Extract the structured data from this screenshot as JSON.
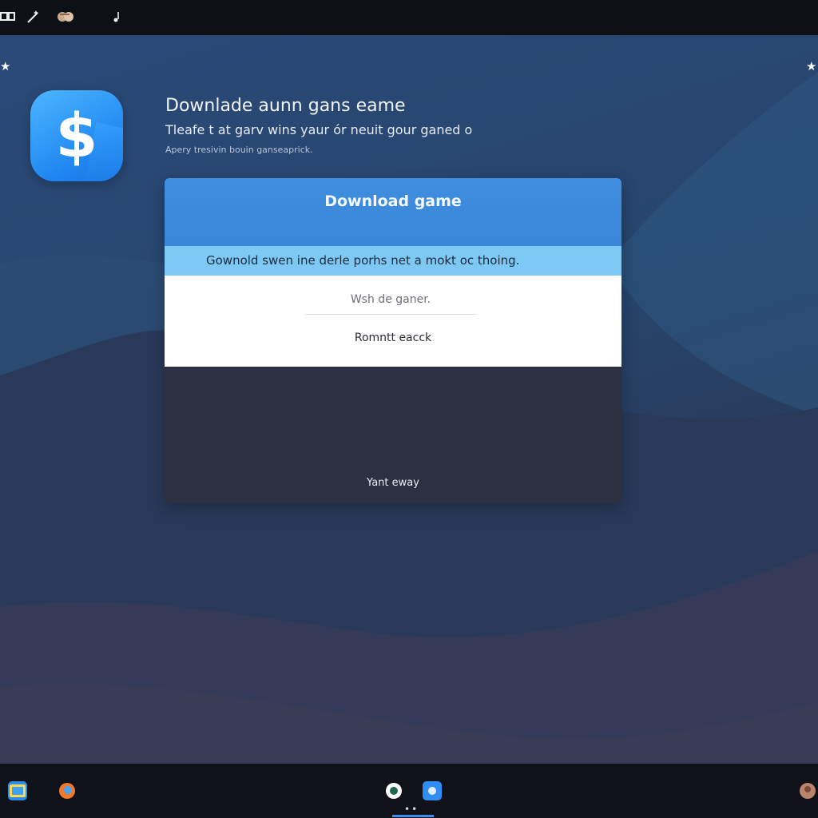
{
  "topbar": {
    "icons": [
      "window-icon",
      "magic-wand-icon",
      "hands-icon",
      "music-note-icon"
    ]
  },
  "app": {
    "icon_name": "dollar-sign-icon",
    "glyph": "$",
    "accent": "#2a8cf0"
  },
  "header": {
    "title": "Downlade aunn gans eame",
    "subtitle": "Tleafe t at garv wins yaur ór neuit gour ganed o",
    "caption": "Apery tresivin bouin ganseaprick."
  },
  "dialog": {
    "title": "Download game",
    "banner": "Gownold swen ine derle porhs net a mokt oc thoing.",
    "input_placeholder": "Wsh de ganer.",
    "secondary_link": "Romntt eacck",
    "dark_button": "Yant eway",
    "colors": {
      "header": "#3b89dc",
      "banner": "#7ec8f4",
      "dark": "#2c3040"
    }
  },
  "taskbar": {
    "icons": [
      "image-icon",
      "browser-icon",
      "circle-app-icon",
      "blue-app-icon",
      "user-avatar-icon"
    ],
    "active_dots": "••"
  }
}
